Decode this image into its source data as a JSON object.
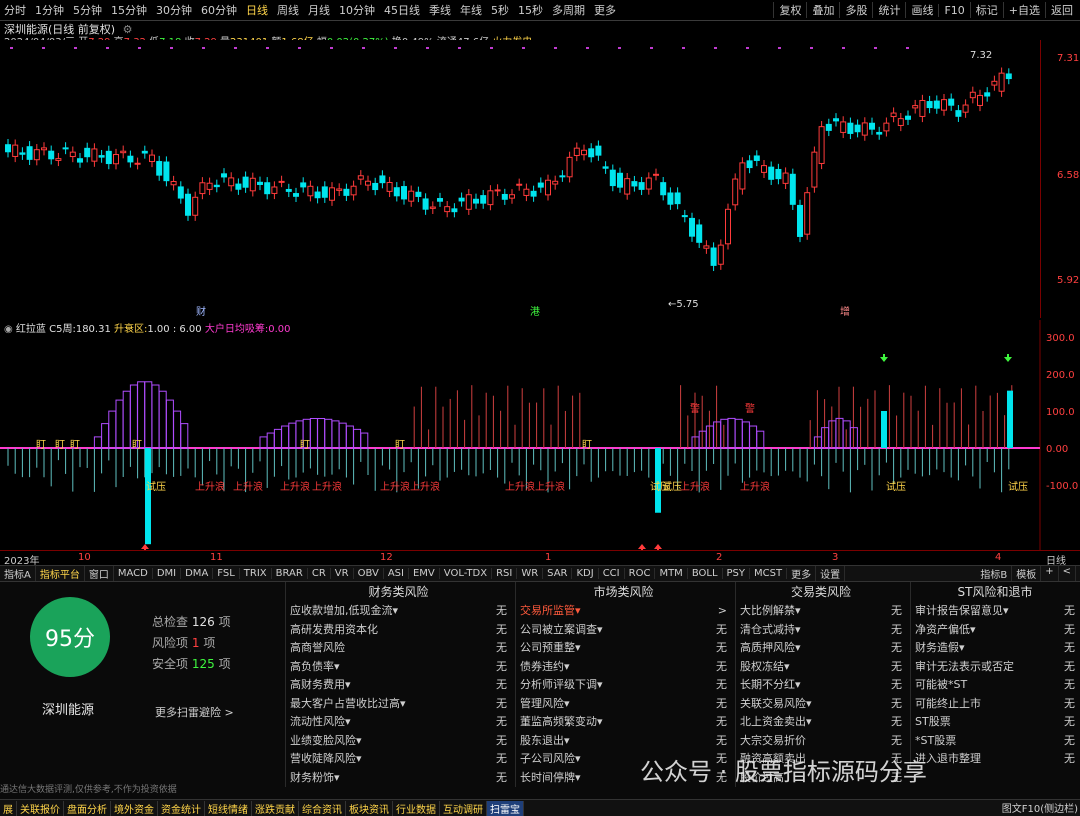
{
  "toolbar": {
    "periods": [
      "分时",
      "1分钟",
      "5分钟",
      "15分钟",
      "30分钟",
      "60分钟",
      "日线",
      "周线",
      "月线",
      "10分钟",
      "45日线",
      "季线",
      "年线",
      "5秒",
      "15秒",
      "多周期",
      "更多"
    ],
    "active_period": "日线",
    "right_buttons": [
      "复权",
      "叠加",
      "多股",
      "统计",
      "画线",
      "F10",
      "标记",
      "+自选",
      "返回"
    ]
  },
  "stock_header": {
    "title": "深圳能源(日线 前复权)",
    "date": "2024/04/03/三",
    "open_label": "开",
    "open": "7.29",
    "high_label": "高",
    "high": "7.32",
    "low_label": "低",
    "low": "7.18",
    "close_label": "收",
    "close": "7.29",
    "volume_label": "量",
    "volume": "231401",
    "amount_label": "额",
    "amount": "1.68亿",
    "change_label": "幅",
    "change": "0.02(0.27%)",
    "turnover_label": "换",
    "turnover": "0.49%",
    "float_label": "流通",
    "float_value": "47.6亿",
    "sector": "火力发电"
  },
  "price_axis": [
    "7.31",
    "6.58",
    "5.92"
  ],
  "price_annotations": {
    "high_label": "7.32",
    "low_label": "5.75",
    "markers": [
      "财",
      "港",
      "增"
    ]
  },
  "indicator_header": {
    "name": "红拉蓝",
    "c5_label": "C5周:",
    "c5_value": "180.31",
    "zone_label": "升衰区:",
    "zone_value": "1.00 : 6.00",
    "hu_label": "大户日均吸筹:",
    "hu_value": "0.00"
  },
  "indicator_axis": [
    "300.0",
    "200.0",
    "100.0",
    "0.00",
    "-100.0"
  ],
  "indicator_labels": {
    "lure": "盯",
    "trial": "试压",
    "rise": "上升浪",
    "jump": "逼",
    "warn": "警"
  },
  "date_axis": [
    "2023年",
    "10",
    "11",
    "12",
    "1",
    "2",
    "3",
    "4",
    "日线"
  ],
  "indicator_tabs": [
    "指标A",
    "指标平台",
    "窗口",
    "MACD",
    "DMI",
    "DMA",
    "FSL",
    "TRIX",
    "BRAR",
    "CR",
    "VR",
    "OBV",
    "ASI",
    "EMV",
    "VOL-TDX",
    "RSI",
    "WR",
    "SAR",
    "KDJ",
    "CCI",
    "ROC",
    "MTM",
    "BOLL",
    "PSY",
    "MCST",
    "更多",
    "设置"
  ],
  "indicator_tabs_right": [
    "指标B",
    "模板",
    "+",
    "<"
  ],
  "risk": {
    "score": "95分",
    "stock_name": "深圳能源",
    "total_label": "总检查",
    "total": "126",
    "total_unit": "项",
    "risk_label": "风险项",
    "risk_count": "1",
    "risk_unit": "项",
    "safe_label": "安全项",
    "safe_count": "125",
    "safe_unit": "项",
    "more_link": "更多扫雷避险 >",
    "disclaimer": "通达信大数据评测,仅供参考,不作为投资依据",
    "columns": [
      {
        "title": "财务类风险",
        "items": [
          {
            "n": "应收款增加,低现金流▾",
            "v": "无"
          },
          {
            "n": "高研发费用资本化",
            "v": "无"
          },
          {
            "n": "高商誉风险",
            "v": "无"
          },
          {
            "n": "高负债率▾",
            "v": "无"
          },
          {
            "n": "高财务费用▾",
            "v": "无"
          },
          {
            "n": "最大客户占营收比过高▾",
            "v": "无"
          },
          {
            "n": "流动性风险▾",
            "v": "无"
          },
          {
            "n": "业绩变脸风险▾",
            "v": "无"
          },
          {
            "n": "营收陡降风险▾",
            "v": "无"
          },
          {
            "n": "财务粉饰▾",
            "v": "无"
          }
        ]
      },
      {
        "title": "市场类风险",
        "items": [
          {
            "n": "交易所监管▾",
            "v": ">",
            "warn": true
          },
          {
            "n": "公司被立案调查▾",
            "v": "无"
          },
          {
            "n": "公司预重整▾",
            "v": "无"
          },
          {
            "n": "债券违约▾",
            "v": "无"
          },
          {
            "n": "分析师评级下调▾",
            "v": "无"
          },
          {
            "n": "管理风险▾",
            "v": "无"
          },
          {
            "n": "董监高频繁变动▾",
            "v": "无"
          },
          {
            "n": "股东退出▾",
            "v": "无"
          },
          {
            "n": "子公司风险▾",
            "v": "无"
          },
          {
            "n": "长时间停牌▾",
            "v": "无"
          }
        ]
      },
      {
        "title": "交易类风险",
        "items": [
          {
            "n": "大比例解禁▾",
            "v": "无"
          },
          {
            "n": "清仓式减持▾",
            "v": "无"
          },
          {
            "n": "高质押风险▾",
            "v": "无"
          },
          {
            "n": "股权冻结▾",
            "v": "无"
          },
          {
            "n": "长期不分红▾",
            "v": "无"
          },
          {
            "n": "关联交易风险▾",
            "v": "无"
          },
          {
            "n": "北上资金卖出▾",
            "v": "无"
          },
          {
            "n": "大宗交易折价",
            "v": "无"
          },
          {
            "n": "融资高额卖出",
            "v": "无"
          },
          {
            "n": "股价过高",
            "v": "无"
          }
        ]
      },
      {
        "title": "ST风险和退市",
        "items": [
          {
            "n": "审计报告保留意见▾",
            "v": "无"
          },
          {
            "n": "净资产偏低▾",
            "v": "无"
          },
          {
            "n": "财务造假▾",
            "v": "无"
          },
          {
            "n": "审计无法表示或否定",
            "v": "无"
          },
          {
            "n": "可能被*ST",
            "v": "无"
          },
          {
            "n": "可能终止上市",
            "v": "无"
          },
          {
            "n": "ST股票",
            "v": "无"
          },
          {
            "n": "*ST股票",
            "v": "无"
          },
          {
            "n": "进入退市整理",
            "v": "无"
          }
        ]
      }
    ]
  },
  "bottom_tabs": [
    "展",
    "关联报价",
    "盘面分析",
    "境外资金",
    "资金统计",
    "短线情绪",
    "涨跌贡献",
    "综合资讯",
    "板块资讯",
    "行业数据",
    "互动调研",
    "扫雷宝"
  ],
  "bottom_right": "图文F10",
  "bottom_right2": "(侧边栏)",
  "watermark": "公众号 · 股票指标源码分享",
  "colors": {
    "up": "#ff3b3b",
    "down": "#00e5ee",
    "purple": "#b04dff",
    "axis": "#7a0000",
    "warn": "#ff5a3c",
    "score": "#1aa35a"
  }
}
